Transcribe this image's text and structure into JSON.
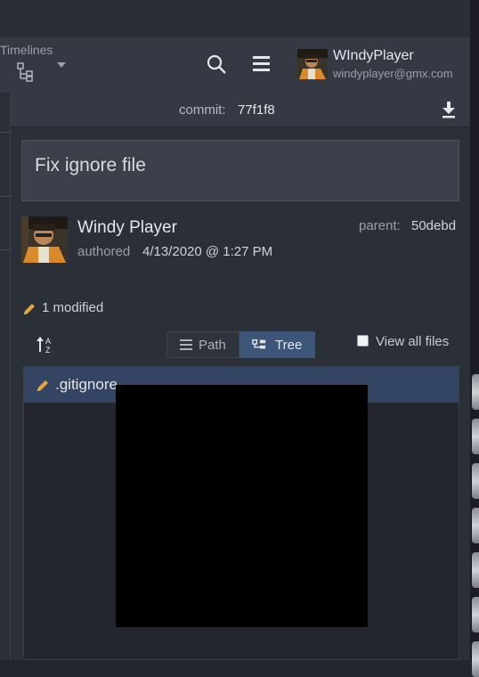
{
  "toolbar": {
    "timelines_label": "Timelines",
    "user_name": "WIndyPlayer",
    "user_email": "windyplayer@gmx.com"
  },
  "commit": {
    "label": "commit:",
    "hash": "77f1f8",
    "message": "Fix ignore file",
    "author_name": "Windy Player",
    "authored_label": "authored",
    "authored_date": "4/13/2020 @ 1:27 PM",
    "parent_label": "parent:",
    "parent_hash": "50debd"
  },
  "changes": {
    "summary": "1 modified",
    "view_path_label": "Path",
    "view_tree_label": "Tree",
    "view_all_label": "View all files",
    "view_all_checked": false,
    "files": [
      {
        "name": ".gitignore",
        "status": "modified"
      }
    ]
  },
  "colors": {
    "accent": "#3d5579",
    "modified": "#e8a33d",
    "selected_row": "#334563"
  },
  "icons": [
    "timelines-icon",
    "chevron-down-icon",
    "search-icon",
    "menu-icon",
    "download-icon",
    "pencil-icon",
    "sort-az-icon",
    "list-icon",
    "tree-icon"
  ]
}
